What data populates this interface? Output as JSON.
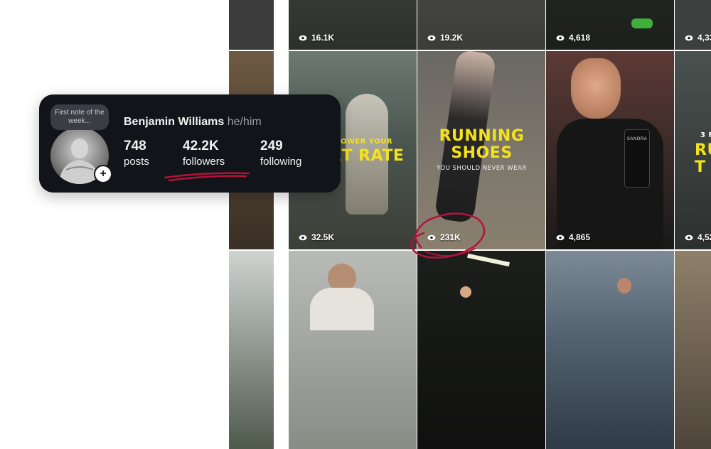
{
  "profile": {
    "note": "First note of the week...",
    "name": "Benjamin Williams",
    "pronouns": "he/him",
    "stats": [
      {
        "value": "748",
        "label": "posts"
      },
      {
        "value": "42.2K",
        "label": "followers"
      },
      {
        "value": "249",
        "label": "following"
      }
    ]
  },
  "grid": {
    "tiles": [
      {
        "views": "16.1K"
      },
      {
        "views": "19.2K"
      },
      {
        "views": "4,618"
      },
      {
        "views": "4,33"
      },
      {
        "views": "32.5K",
        "overlay_top": "TO LOWER YOUR",
        "overlay_big": "RT RATE"
      },
      {
        "views": "231K",
        "overlay_big": "RUNNING SHOES",
        "overlay_small": "YOU SHOULD NEVER WEAR"
      },
      {
        "views": "4,865",
        "bottle_label": "SANORA"
      },
      {
        "views": "4,52",
        "overlay_top": "3 F",
        "overlay_big": "RU T"
      }
    ]
  },
  "colors": {
    "accent_yellow": "#f4e21a",
    "scribble_red": "#b3123a",
    "card_bg": "#111419"
  }
}
